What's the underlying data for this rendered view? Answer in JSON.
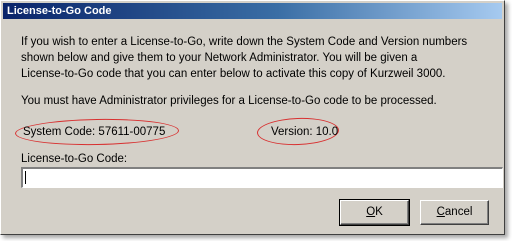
{
  "window": {
    "title": "License-to-Go Code"
  },
  "instructions": {
    "lines": [
      "If you wish to enter a License-to-Go, write down the System Code and Version numbers",
      "shown below and give them to your Network Administrator.  You will be given a",
      "License-to-Go code that you can enter below to activate this copy of Kurzweil 3000."
    ],
    "admin_note": "You must have Administrator privileges for a License-to-Go code to be processed."
  },
  "system_code": {
    "text": "System Code: 57611-00775"
  },
  "version": {
    "text": "Version: 10.0"
  },
  "license_field": {
    "label": "License-to-Go Code:",
    "value": "",
    "placeholder": ""
  },
  "buttons": {
    "ok": {
      "mnemonic": "O",
      "rest": "K"
    },
    "cancel": {
      "mnemonic": "C",
      "rest": "ancel"
    }
  },
  "colors": {
    "title_bar_start": "#0a246a",
    "title_bar_end": "#a6caf0",
    "highlight_oval": "#d83030",
    "dialog_face": "#d4d0c8"
  }
}
